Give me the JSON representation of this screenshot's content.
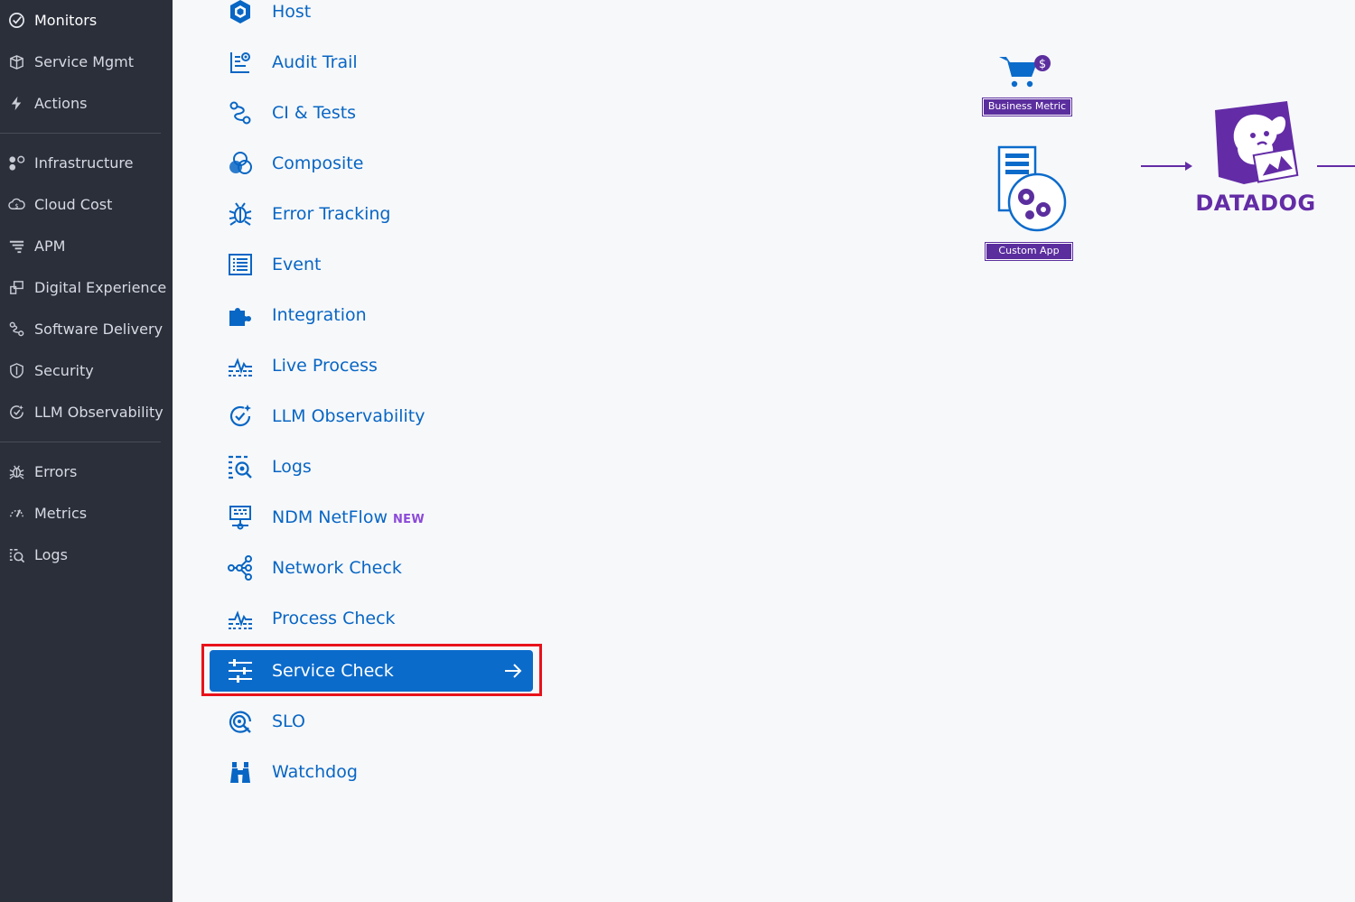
{
  "sidebar": {
    "items": [
      {
        "label": "Monitors",
        "icon": "monitors-icon",
        "active": true
      },
      {
        "label": "Service Mgmt",
        "icon": "service-mgmt-icon"
      },
      {
        "label": "Actions",
        "icon": "lightning-icon"
      },
      {
        "label": "Infrastructure",
        "icon": "infrastructure-icon"
      },
      {
        "label": "Cloud Cost",
        "icon": "cloud-cost-icon"
      },
      {
        "label": "APM",
        "icon": "apm-icon"
      },
      {
        "label": "Digital Experience",
        "icon": "digital-experience-icon"
      },
      {
        "label": "Software Delivery",
        "icon": "software-delivery-icon"
      },
      {
        "label": "Security",
        "icon": "shield-icon"
      },
      {
        "label": "LLM Observability",
        "icon": "llm-observability-icon"
      },
      {
        "label": "Errors",
        "icon": "bug-icon"
      },
      {
        "label": "Metrics",
        "icon": "metrics-icon"
      },
      {
        "label": "Logs",
        "icon": "logs-icon"
      }
    ]
  },
  "monitor_types": [
    {
      "label": "Host",
      "icon": "host-icon"
    },
    {
      "label": "Audit Trail",
      "icon": "audit-trail-icon"
    },
    {
      "label": "CI & Tests",
      "icon": "ci-tests-icon"
    },
    {
      "label": "Composite",
      "icon": "composite-icon"
    },
    {
      "label": "Error Tracking",
      "icon": "error-tracking-icon"
    },
    {
      "label": "Event",
      "icon": "event-icon"
    },
    {
      "label": "Integration",
      "icon": "integration-icon"
    },
    {
      "label": "Live Process",
      "icon": "live-process-icon"
    },
    {
      "label": "LLM Observability",
      "icon": "llm-observability-icon"
    },
    {
      "label": "Logs",
      "icon": "logs-icon"
    },
    {
      "label": "NDM NetFlow",
      "icon": "ndm-netflow-icon",
      "badge": "NEW"
    },
    {
      "label": "Network Check",
      "icon": "network-check-icon"
    },
    {
      "label": "Process Check",
      "icon": "process-check-icon"
    },
    {
      "label": "Service Check",
      "icon": "service-check-icon",
      "selected": true
    },
    {
      "label": "SLO",
      "icon": "slo-icon"
    },
    {
      "label": "Watchdog",
      "icon": "binoculars-icon"
    }
  ],
  "illustration": {
    "business_metric_label": "Business Metric",
    "custom_app_label": "Custom App",
    "brand": "DATADOG",
    "brand_color": "#632ca6",
    "accent_color": "#0b6bcb",
    "highlight_color": "#e8121a"
  }
}
